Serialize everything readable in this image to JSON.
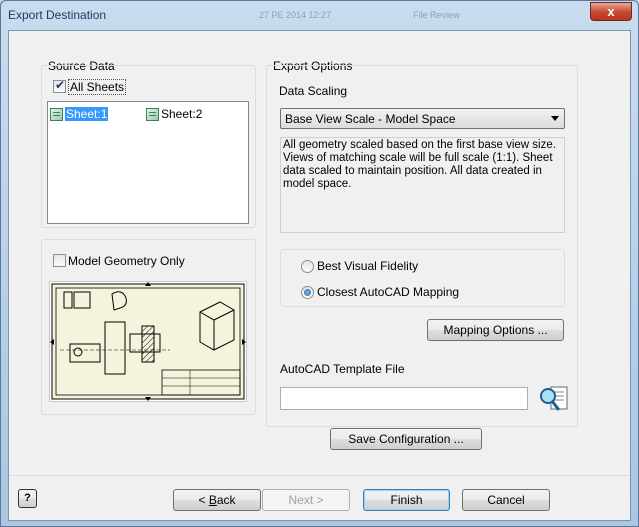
{
  "window": {
    "title": "Export Destination",
    "ghost_title_left": "27 РЕ 2014 12:27",
    "ghost_title_right": "File Review",
    "close_glyph": "x"
  },
  "source_data": {
    "group_label": "Source Data",
    "all_sheets": {
      "label": "All Sheets",
      "checked": true
    },
    "sheets": [
      {
        "label": "Sheet:1",
        "selected": true
      },
      {
        "label": "Sheet:2",
        "selected": false
      }
    ],
    "model_geometry_only": {
      "label": "Model Geometry Only",
      "checked": false
    }
  },
  "export_options": {
    "group_label": "Export Options",
    "data_scaling_label": "Data Scaling",
    "data_scaling_value": "Base View Scale - Model Space",
    "description": "All geometry scaled based on the first base view size. Views of matching scale will be full scale (1:1). Sheet data scaled to maintain position. All data created in model space.",
    "radios": [
      {
        "label": "Best Visual Fidelity",
        "selected": false
      },
      {
        "label": "Closest AutoCAD Mapping",
        "selected": true
      }
    ],
    "mapping_options_label": "Mapping Options ...",
    "template_label": "AutoCAD Template File",
    "template_value": ""
  },
  "save_configuration_label": "Save Configuration ...",
  "footer": {
    "help_glyph": "?",
    "back_label_prefix": "< ",
    "back_label_key": "B",
    "back_label_rest": "ack",
    "next_label": "Next >",
    "finish_label": "Finish",
    "cancel_label": "Cancel"
  },
  "colors": {
    "selection": "#3399ff",
    "close_button": "#c7452c",
    "client_bg": "#f0f0f0"
  }
}
